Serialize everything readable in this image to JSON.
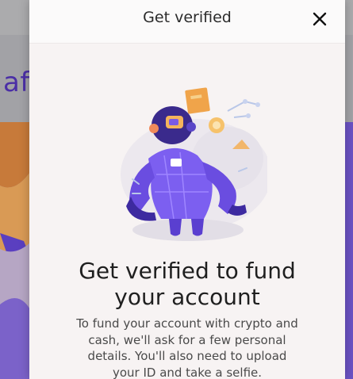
{
  "background": {
    "headline_fragment": "af"
  },
  "modal": {
    "title": "Get verified",
    "close_icon": "close-icon",
    "illustration": "robot-verification-illustration",
    "heading": "Get verified to fund your account",
    "body": "To fund your account with crypto and cash, we'll ask for a few personal details. You'll also need to upload your ID and take a selfie."
  },
  "colors": {
    "accent": "#6b4fe0",
    "brand_purple": "#4b2fa6",
    "modal_bg": "#f7f3f3"
  }
}
